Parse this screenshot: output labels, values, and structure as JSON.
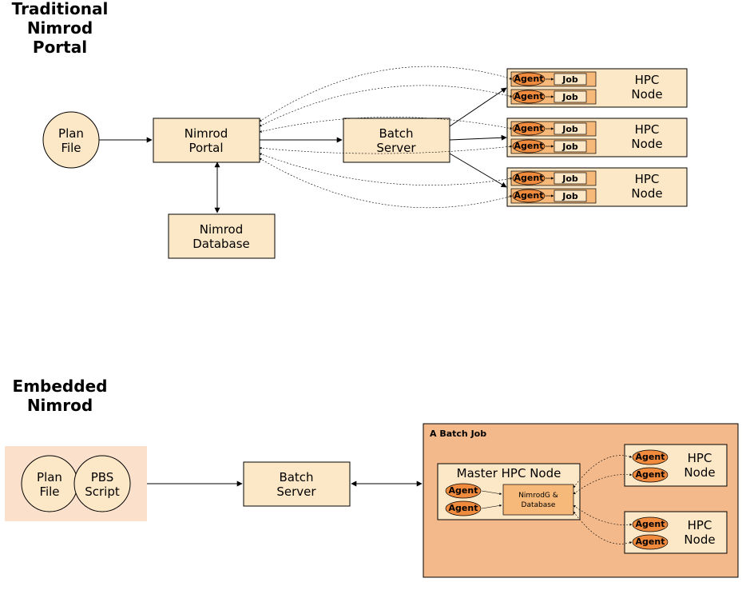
{
  "titles": {
    "top1": "Traditional",
    "top2": "Nimrod",
    "top3": "Portal",
    "bottom1": "Embedded",
    "bottom2": "Nimrod"
  },
  "nodes": {
    "planFile1": "Plan",
    "planFile2": "File",
    "nimrodPortal1": "Nimrod",
    "nimrodPortal2": "Portal",
    "batchServer1": "Batch",
    "batchServer2": "Server",
    "nimrodDb1": "Nimrod",
    "nimrodDb2": "Database",
    "hpcNode1": "HPC",
    "hpcNode2": "Node",
    "agent": "Agent",
    "job": "Job",
    "pbsScript1": "PBS",
    "pbsScript2": "Script",
    "batchJobTitle": "A Batch Job",
    "masterHpc": "Master HPC Node",
    "nimrodG1": "NimrodG &",
    "nimrodG2": "Database"
  }
}
